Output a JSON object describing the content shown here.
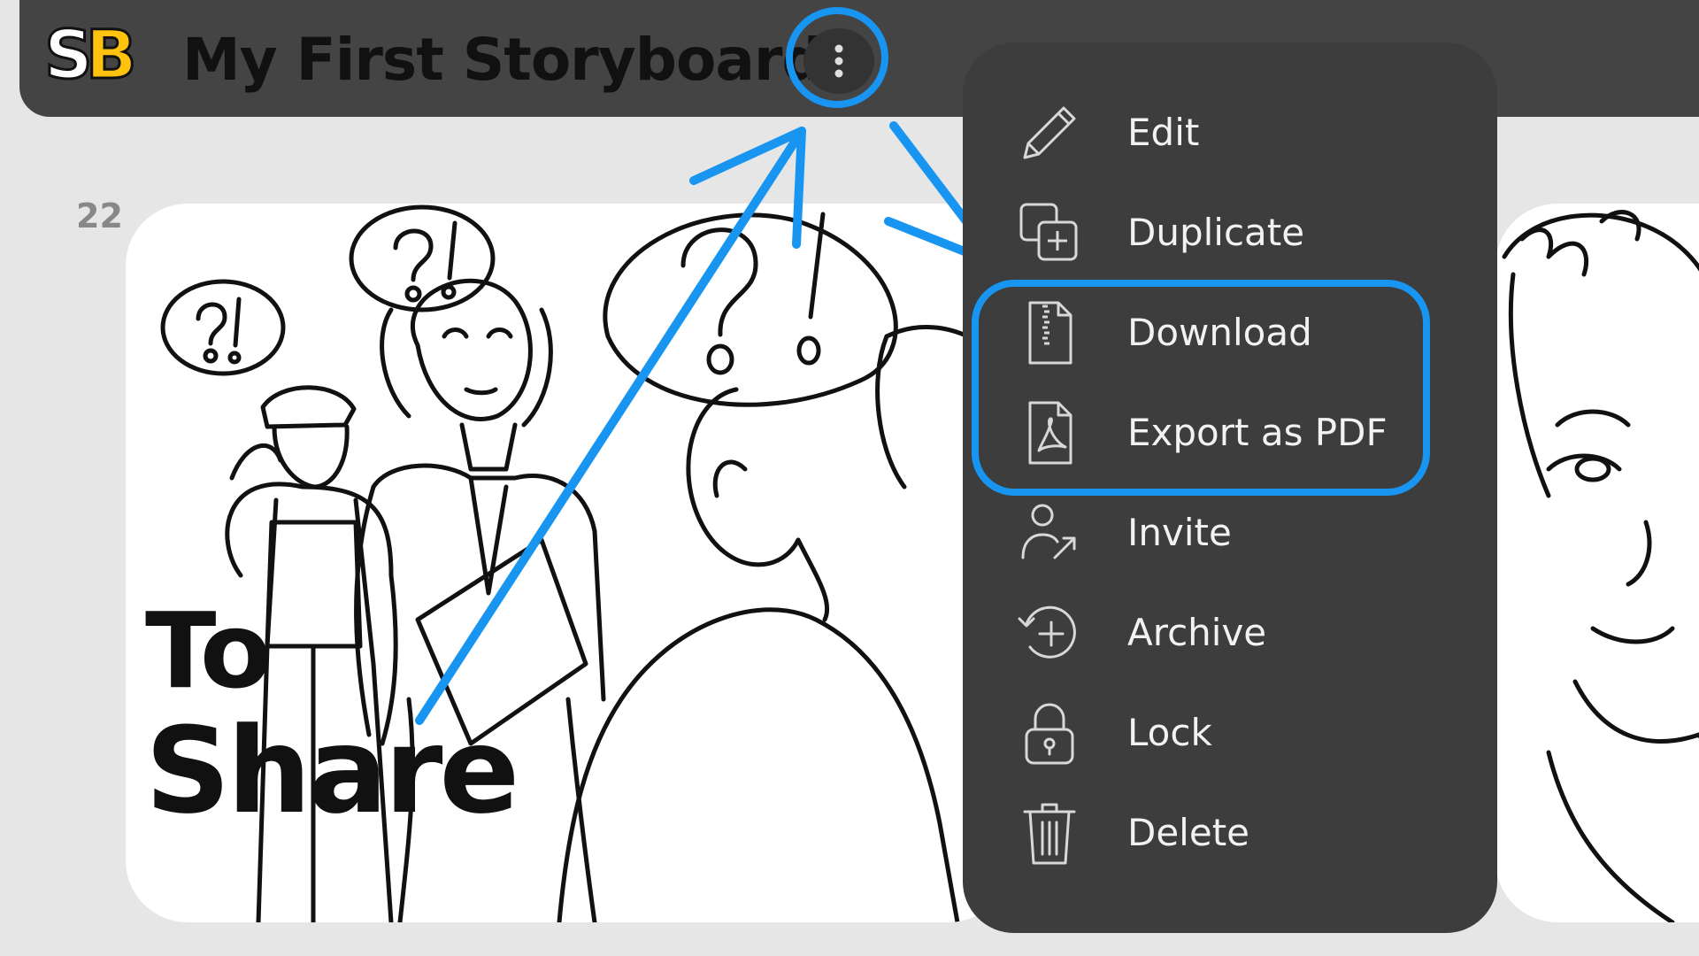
{
  "header": {
    "logo": {
      "s": "S",
      "b": "B"
    },
    "title": "My First Storyboard",
    "more_button_icon": "vertical-ellipsis-icon"
  },
  "page_number": "22",
  "card": {
    "overlay_line1": "To",
    "overlay_line2": "Share"
  },
  "menu": {
    "items": [
      {
        "label": "Edit",
        "icon": "pencil-icon"
      },
      {
        "label": "Duplicate",
        "icon": "duplicate-icon"
      },
      {
        "label": "Download",
        "icon": "zip-file-icon"
      },
      {
        "label": "Export as PDF",
        "icon": "pdf-file-icon"
      },
      {
        "label": "Invite",
        "icon": "invite-user-icon"
      },
      {
        "label": "Archive",
        "icon": "archive-icon"
      },
      {
        "label": "Lock",
        "icon": "lock-icon"
      },
      {
        "label": "Delete",
        "icon": "trash-icon"
      }
    ]
  },
  "colors": {
    "header_bg": "#444444",
    "menu_bg": "#3d3d3d",
    "highlight": "#1795f0",
    "logo_accent": "#ffc20e",
    "page_bg": "#e6e6e6"
  }
}
